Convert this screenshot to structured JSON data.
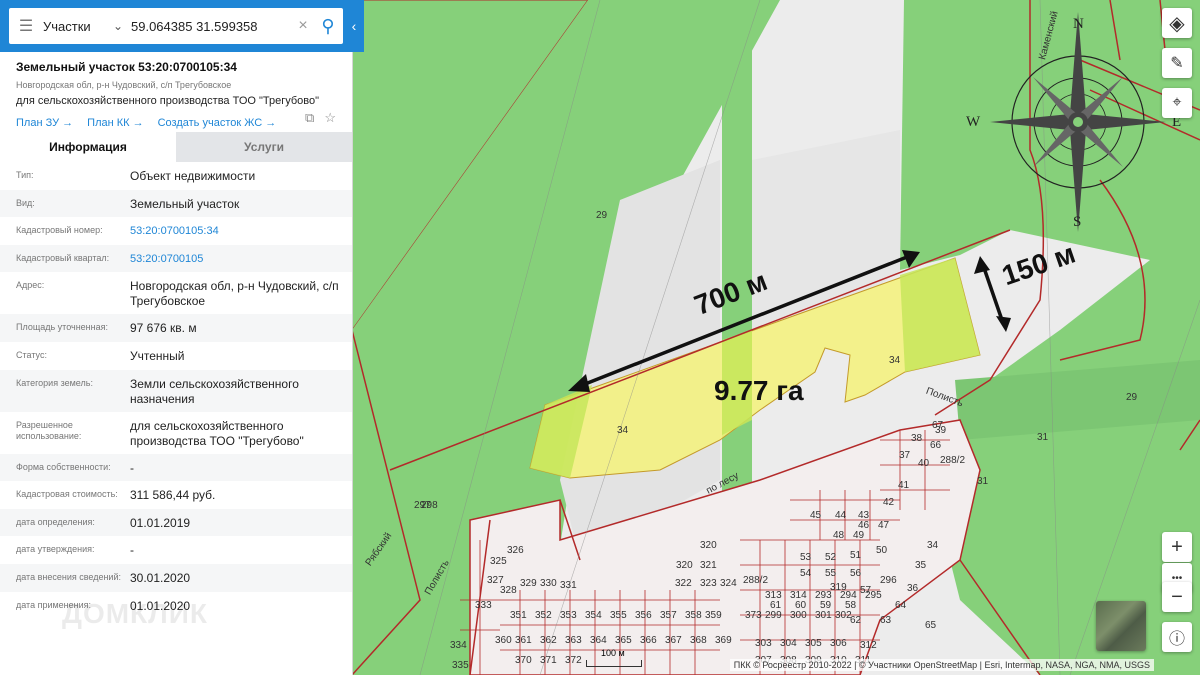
{
  "search": {
    "type_label": "Участки",
    "query": "59.064385 31.599358"
  },
  "object": {
    "title": "Земельный участок 53:20:0700105:34",
    "address_short": "Новгородская обл, р-н Чудовский, с/п Трегубовское",
    "usage_short": "для сельскохозяйственного производства ТОО \"Трегубово\"",
    "links": [
      "План ЗУ",
      "План КК",
      "Создать участок ЖС"
    ]
  },
  "tabs": [
    "Информация",
    "Услуги"
  ],
  "info": [
    {
      "k": "Тип:",
      "v": "Объект недвижимости"
    },
    {
      "k": "Вид:",
      "v": "Земельный участок"
    },
    {
      "k": "Кадастровый номер:",
      "v": "53:20:0700105:34",
      "link": true
    },
    {
      "k": "Кадастровый квартал:",
      "v": "53:20:0700105",
      "link": true
    },
    {
      "k": "Адрес:",
      "v": "Новгородская обл, р-н Чудовский, с/п Трегубовское"
    },
    {
      "k": "Площадь уточненная:",
      "v": "97 676 кв. м"
    },
    {
      "k": "Статус:",
      "v": "Учтенный"
    },
    {
      "k": "Категория земель:",
      "v": "Земли сельскохозяйственного назначения"
    },
    {
      "k": "Разрешенное использование:",
      "v": "для сельскохозяйственного производства ТОО \"Трегубово\""
    },
    {
      "k": "Форма собственности:",
      "v": "-"
    },
    {
      "k": "Кадастровая стоимость:",
      "v": "311 586,44 руб."
    },
    {
      "k": "дата определения:",
      "v": "01.01.2019"
    },
    {
      "k": "дата утверждения:",
      "v": "-"
    },
    {
      "k": "дата внесения сведений:",
      "v": "30.01.2020"
    },
    {
      "k": "дата применения:",
      "v": "01.01.2020"
    }
  ],
  "watermark": "ДОМКЛИК",
  "map": {
    "annotations": {
      "length": "700 м",
      "width": "150 м",
      "area": "9.77 га"
    },
    "compass": [
      "W",
      "E",
      "S",
      "N"
    ],
    "parcel_numbers": [
      "29",
      "29",
      "31",
      "31",
      "34",
      "34",
      "34",
      "35",
      "36",
      "37",
      "38",
      "39",
      "40",
      "41",
      "42",
      "43",
      "44",
      "45",
      "46",
      "47",
      "48",
      "49",
      "50",
      "51",
      "52",
      "53",
      "54",
      "55",
      "56",
      "57",
      "58",
      "59",
      "60",
      "61",
      "62",
      "63",
      "64",
      "65",
      "66",
      "67",
      "288/2",
      "288/2",
      "319",
      "320",
      "320",
      "321",
      "322",
      "323",
      "324",
      "325",
      "326",
      "327",
      "328",
      "329",
      "330",
      "331",
      "333",
      "334",
      "335",
      "351",
      "352",
      "353",
      "354",
      "355",
      "356",
      "357",
      "358",
      "359",
      "360",
      "361",
      "362",
      "363",
      "364",
      "365",
      "366",
      "367",
      "368",
      "369",
      "370",
      "371",
      "372",
      "373",
      "299",
      "300",
      "301",
      "302",
      "303",
      "304",
      "305",
      "306",
      "307",
      "308",
      "309",
      "310",
      "311",
      "312",
      "313",
      "314",
      "293",
      "294",
      "295",
      "296",
      "297",
      "298"
    ],
    "roads": [
      "Полисть",
      "по лесу",
      "Каменский",
      "Полисть",
      "Рябский"
    ],
    "scale": "100 м",
    "attribution": "ПКК © Росреестр 2010-2022 | © Участники OpenStreetMap | Esri, Intermap, NASA, NGA, NMA, USGS",
    "colors": {
      "green": "#86d07a",
      "yellow": "#f4f27a",
      "boundary": "#b32a2a",
      "accent": "#1f86d6"
    }
  }
}
